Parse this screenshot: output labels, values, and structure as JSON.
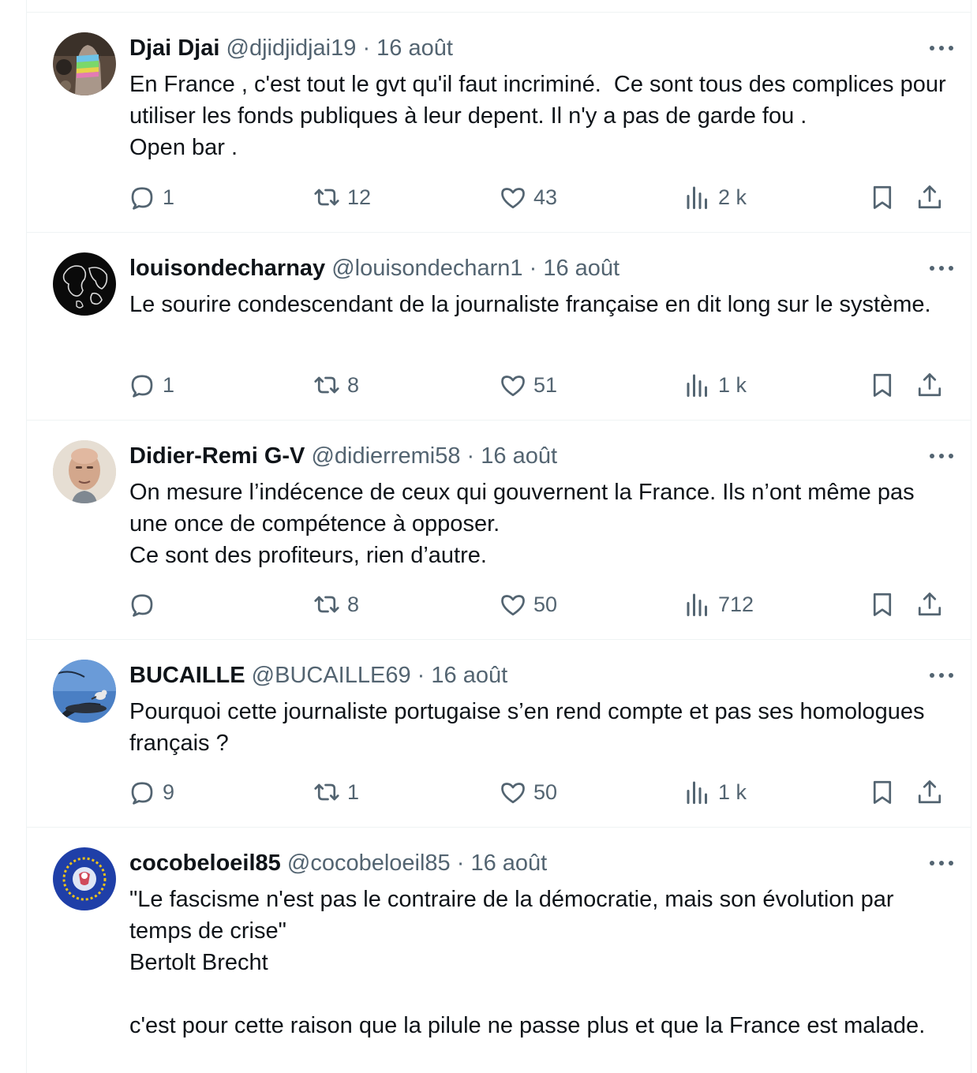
{
  "tweets": [
    {
      "name": "Djai Djai",
      "handle": "@djidjidjai19",
      "separator": "·",
      "date": "16 août",
      "text": "En France , c'est tout le gvt qu'il faut incriminé.  Ce sont tous des complices pour utiliser les fonds publiques à leur depent. Il n'y a pas de garde fou .\nOpen bar .",
      "replies": "1",
      "retweets": "12",
      "likes": "43",
      "views": "2 k",
      "avatar": {
        "theme": "dark-hand-rainbow",
        "bg": "#5a4a3e"
      }
    },
    {
      "name": "louisondecharnay",
      "handle": "@louisondecharn1",
      "separator": "·",
      "date": "16 août",
      "text": "Le sourire condescendant de la journaliste française en dit long sur le système.",
      "replies": "1",
      "retweets": "8",
      "likes": "51",
      "views": "1 k",
      "avatar": {
        "theme": "black-world-map-outline",
        "bg": "#0a0a0a"
      }
    },
    {
      "name": "Didier-Remi G-V",
      "handle": "@didierremi58",
      "separator": "·",
      "date": "16 août",
      "text": "On mesure l’indécence de ceux qui gouvernent la France. Ils n’ont même pas une once de compétence à opposer.\nCe sont des profiteurs, rien d’autre.",
      "replies": "",
      "retweets": "8",
      "likes": "50",
      "views": "712",
      "avatar": {
        "theme": "bald-man-portrait",
        "bg": "#d8cfc4"
      }
    },
    {
      "name": "BUCAILLE",
      "handle": "@BUCAILLE69",
      "separator": "·",
      "date": "16 août",
      "text": "Pourquoi cette journaliste portugaise s’en rend compte et pas ses homologues français ?",
      "replies": "9",
      "retweets": "1",
      "likes": "50",
      "views": "1 k",
      "avatar": {
        "theme": "bird-on-lamp-blue-sky",
        "bg": "#4a7fc4"
      }
    },
    {
      "name": "cocobeloeil85",
      "handle": "@cocobeloeil85",
      "separator": "·",
      "date": "16 août",
      "text": "\"Le fascisme n'est pas le contraire de la démocratie, mais son évolution par temps de crise\"\nBertolt Brecht\n\nc'est pour cette raison que la pilule ne passe plus et que la France est malade.",
      "replies": "",
      "retweets": "",
      "likes": "",
      "views": "",
      "avatar": {
        "theme": "eu-flag-stars-with-emblem",
        "bg": "#1f3fa8"
      }
    }
  ],
  "icons": {
    "reply": "reply-icon",
    "retweet": "retweet-icon",
    "like": "heart-icon",
    "views": "views-bar-chart-icon",
    "bookmark": "bookmark-icon",
    "share": "share-upload-icon",
    "more": "more-dots-icon"
  },
  "colors": {
    "text": "#0f1419",
    "secondary": "#536471",
    "divider": "#eff3f4"
  }
}
